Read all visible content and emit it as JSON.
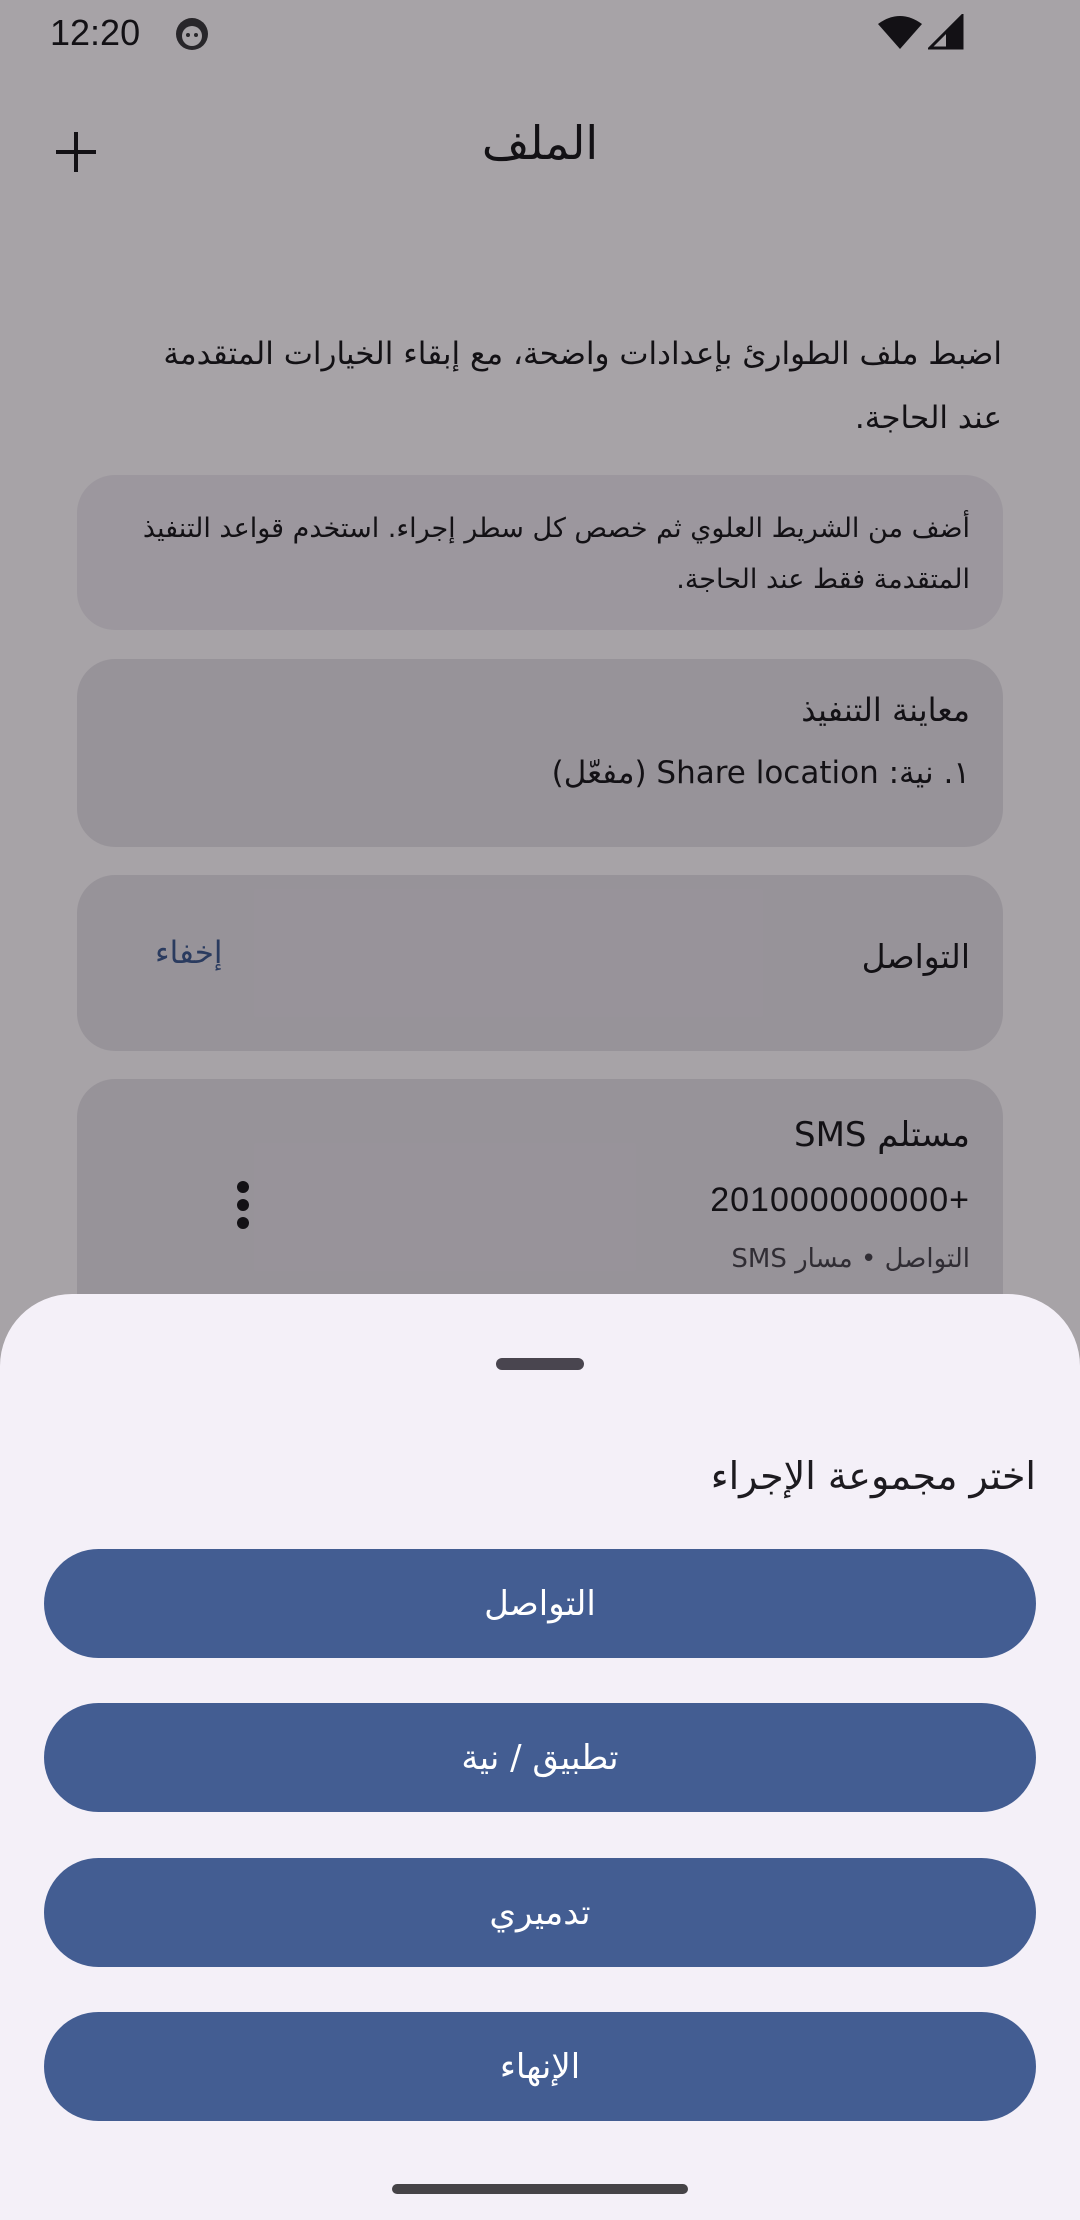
{
  "status_bar": {
    "time": "12:20",
    "icons": [
      "face-icon",
      "wifi-icon",
      "cell-signal-icon"
    ]
  },
  "app_bar": {
    "title": "الملف",
    "add_icon": "plus-icon"
  },
  "content": {
    "intro": "اضبط ملف الطوارئ بإعدادات واضحة، مع إبقاء الخيارات المتقدمة عند الحاجة.",
    "hint": "أضف من الشريط العلوي ثم خصص كل سطر إجراء. استخدم قواعد التنفيذ المتقدمة فقط عند الحاجة.",
    "preview": {
      "title": "معاينة التنفيذ",
      "line": "١. نية: Share location (مفعّل)"
    },
    "group": {
      "title": "التواصل",
      "hide_label": "إخفاء"
    },
    "action": {
      "title": "مستلم SMS",
      "number": "+201000000000",
      "meta": "التواصل • مسار SMS",
      "more_icon": "more-vertical-icon"
    }
  },
  "sheet": {
    "title": "اختر مجموعة الإجراء",
    "options": [
      "التواصل",
      "تطبيق / نية",
      "تدميري",
      "الإنهاء"
    ]
  },
  "colors": {
    "primary": "#435d92",
    "link": "#415a91",
    "sheet_bg": "#f4f0f8",
    "card_bg": "#e6dfe9",
    "text": "#1d1b20"
  }
}
